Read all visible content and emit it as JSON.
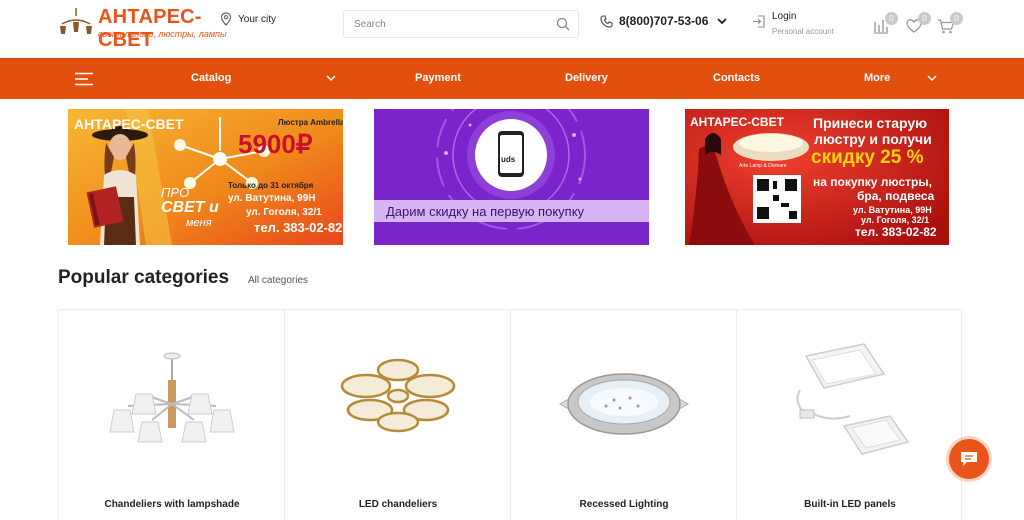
{
  "header": {
    "logo_title": "АНТАРЕС-СВЕТ",
    "logo_subtitle": "светильники, люстры, лампы",
    "city_label": "Your city",
    "search_placeholder": "Search",
    "phone": "8(800)707-53-06",
    "login_label": "Login",
    "account_label": "Personal account",
    "compare_count": "0",
    "favorites_count": "0",
    "cart_count": "0"
  },
  "nav": {
    "items": [
      {
        "label": "Catalog"
      },
      {
        "label": "Payment"
      },
      {
        "label": "Delivery"
      },
      {
        "label": "Contacts"
      },
      {
        "label": "More"
      }
    ]
  },
  "banners": {
    "b1": {
      "brand": "АНТАРЕС-СВЕТ",
      "product": "Люстра Ambrella",
      "price": "5900₽",
      "until": "Только до 31 октября",
      "slogan_1": "ПРО",
      "slogan_2": "СВЕТ и",
      "slogan_3": "меня",
      "address_1": "ул. Ватутина, 99Н",
      "address_2": "ул. Гоголя, 32/1",
      "tel": "тел. 383-02-82"
    },
    "b2": {
      "app_label": "uds",
      "caption": "Дарим скидку на первую покупку"
    },
    "b3": {
      "brand": "АНТАРЕС-СВЕТ",
      "headline_1": "Принеси старую",
      "headline_2": "люстру и получи",
      "discount": "скидку 25 %",
      "line_1": "на покупку люстры,",
      "line_2": "бра, подвеса",
      "brand_partner": "Arte Lamp & Divinare",
      "address_1": "ул. Ватутина, 99Н",
      "address_2": "ул. Гоголя, 32/1",
      "tel": "тел. 383-02-82"
    }
  },
  "popular": {
    "title": "Popular categories",
    "all_link": "All categories",
    "categories": [
      {
        "label": "Chandeliers with lampshade"
      },
      {
        "label": "LED chandeliers"
      },
      {
        "label": "Recessed Lighting"
      },
      {
        "label": "Built-in LED panels"
      }
    ]
  },
  "colors": {
    "brand_orange": "#e34f0d",
    "banner_purple": "#7b24c9",
    "banner_red": "#d6221f"
  }
}
